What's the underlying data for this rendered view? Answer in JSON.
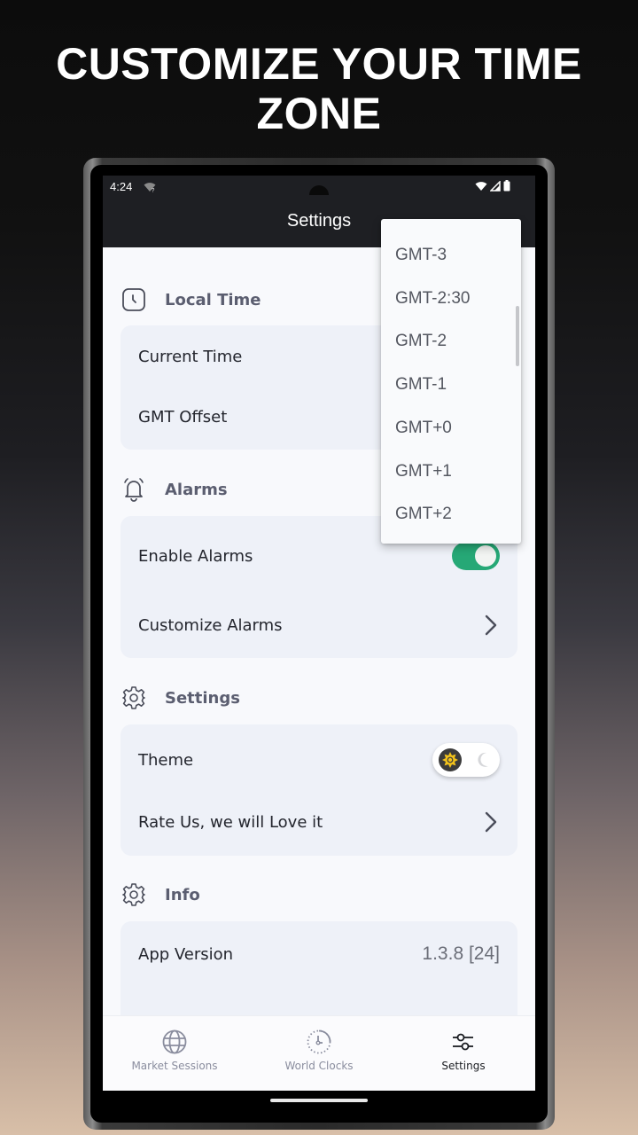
{
  "promo": {
    "title_line1": "CUSTOMIZE YOUR TIME",
    "title_line2": "ZONE"
  },
  "status_bar": {
    "time": "4:24",
    "icons": [
      "wifi-question-icon",
      "wifi-icon",
      "signal-icon",
      "battery-icon"
    ]
  },
  "app_bar": {
    "title": "Settings"
  },
  "sections": {
    "local_time": {
      "label": "Local Time",
      "icon": "clock-icon",
      "rows": [
        {
          "label": "Current Time"
        },
        {
          "label": "GMT Offset"
        }
      ]
    },
    "alarms": {
      "label": "Alarms",
      "icon": "bell-icon",
      "rows": [
        {
          "label": "Enable Alarms",
          "toggle_on": true
        },
        {
          "label": "Customize Alarms"
        }
      ]
    },
    "settings": {
      "label": "Settings",
      "icon": "gear-icon",
      "rows": [
        {
          "label": "Theme",
          "theme": "light"
        },
        {
          "label": "Rate Us, we will Love it"
        }
      ]
    },
    "info": {
      "label": "Info",
      "icon": "gear-icon",
      "rows": [
        {
          "label": "App Version",
          "value": "1.3.8 [24]"
        }
      ]
    }
  },
  "gmt_dropdown": {
    "options": [
      "GMT-3",
      "GMT-2:30",
      "GMT-2",
      "GMT-1",
      "GMT+0",
      "GMT+1",
      "GMT+2"
    ]
  },
  "bottom_nav": {
    "items": [
      {
        "label": "Market Sessions",
        "icon": "globe-icon",
        "active": false
      },
      {
        "label": "World Clocks",
        "icon": "world-clock-icon",
        "active": false
      },
      {
        "label": "Settings",
        "icon": "sliders-icon",
        "active": true
      }
    ]
  },
  "colors": {
    "accent_green": "#26a876",
    "app_bar_bg": "#1e1f23",
    "card_bg": "#eef1f8",
    "sun_yellow": "#f2c21b"
  }
}
